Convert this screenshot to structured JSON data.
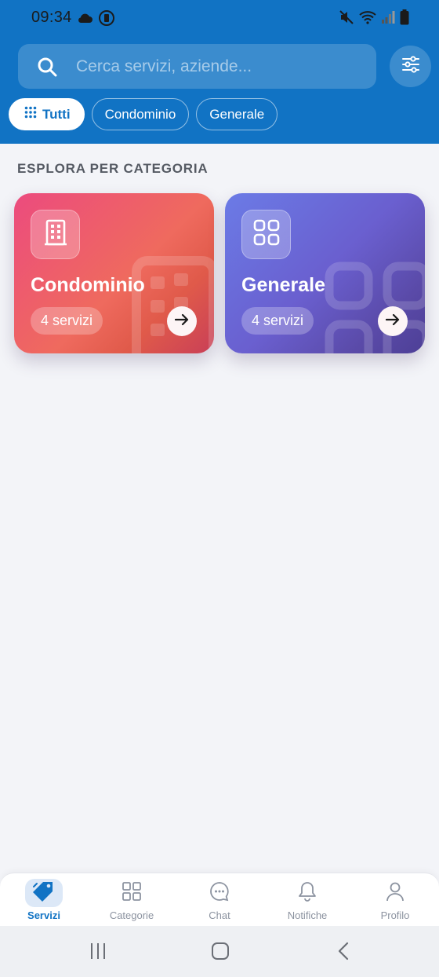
{
  "status_bar": {
    "time": "09:34"
  },
  "search": {
    "placeholder": "Cerca servizi, aziende..."
  },
  "chips": [
    {
      "label": "Tutti",
      "active": true
    },
    {
      "label": "Condominio",
      "active": false
    },
    {
      "label": "Generale",
      "active": false
    }
  ],
  "section": {
    "title": "ESPLORA PER CATEGORIA"
  },
  "categories": [
    {
      "title": "Condominio",
      "badge": "4 servizi",
      "icon": "building-icon",
      "colors": [
        "#ec4b7e",
        "#ef6a5e",
        "#c93f57"
      ]
    },
    {
      "title": "Generale",
      "badge": "4 servizi",
      "icon": "grid-squares-icon",
      "colors": [
        "#6b7be6",
        "#6a5fcf",
        "#4d3f96"
      ]
    }
  ],
  "bottom_nav": [
    {
      "label": "Servizi",
      "icon": "tag-icon",
      "active": true
    },
    {
      "label": "Categorie",
      "icon": "grid-icon",
      "active": false
    },
    {
      "label": "Chat",
      "icon": "chat-bubble-icon",
      "active": false
    },
    {
      "label": "Notifiche",
      "icon": "bell-icon",
      "active": false
    },
    {
      "label": "Profilo",
      "icon": "user-icon",
      "active": false
    }
  ],
  "colors": {
    "primary": "#1173c4",
    "background": "#f3f4f8",
    "nav_inactive": "#8c93a0"
  }
}
